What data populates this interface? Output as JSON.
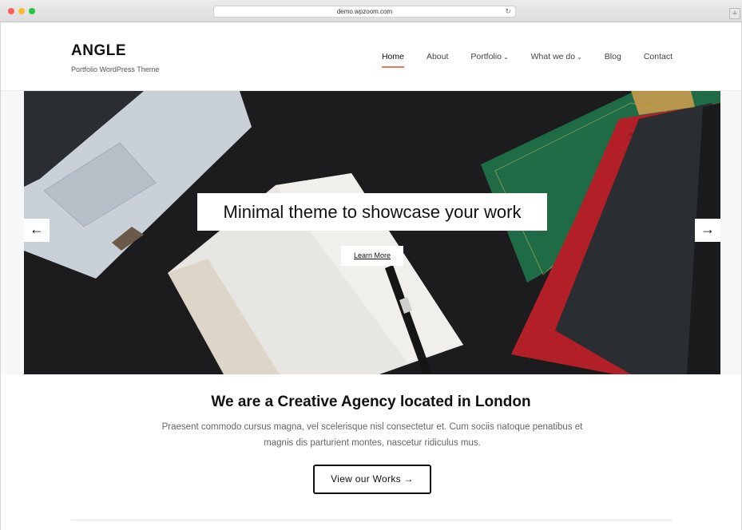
{
  "browser": {
    "url": "demo.wpzoom.com",
    "reload_icon": "reload-icon",
    "newtab_icon": "plus-icon"
  },
  "header": {
    "title": "ANGLE",
    "tagline": "Portfolio WordPress Theme"
  },
  "nav": {
    "items": [
      {
        "label": "Home",
        "active": true
      },
      {
        "label": "About"
      },
      {
        "label": "Portfolio",
        "dropdown": true
      },
      {
        "label": "What we do",
        "dropdown": true
      },
      {
        "label": "Blog"
      },
      {
        "label": "Contact"
      }
    ],
    "dropdown_icon": "chevron-down-icon"
  },
  "hero": {
    "title": "Minimal theme to showcase your work",
    "button": "Learn More",
    "prev_icon": "arrow-left-icon",
    "next_icon": "arrow-right-icon"
  },
  "agency": {
    "title": "We are a Creative Agency located in London",
    "text": "Praesent commodo cursus magna, vel scelerisque nisl consectetur et. Cum sociis natoque penatibus et magnis dis parturient montes, nascetur ridiculus mus.",
    "button": "View our Works →"
  },
  "colors": {
    "accent": "#e8775b",
    "hero_bg": "#1b1b1d"
  }
}
